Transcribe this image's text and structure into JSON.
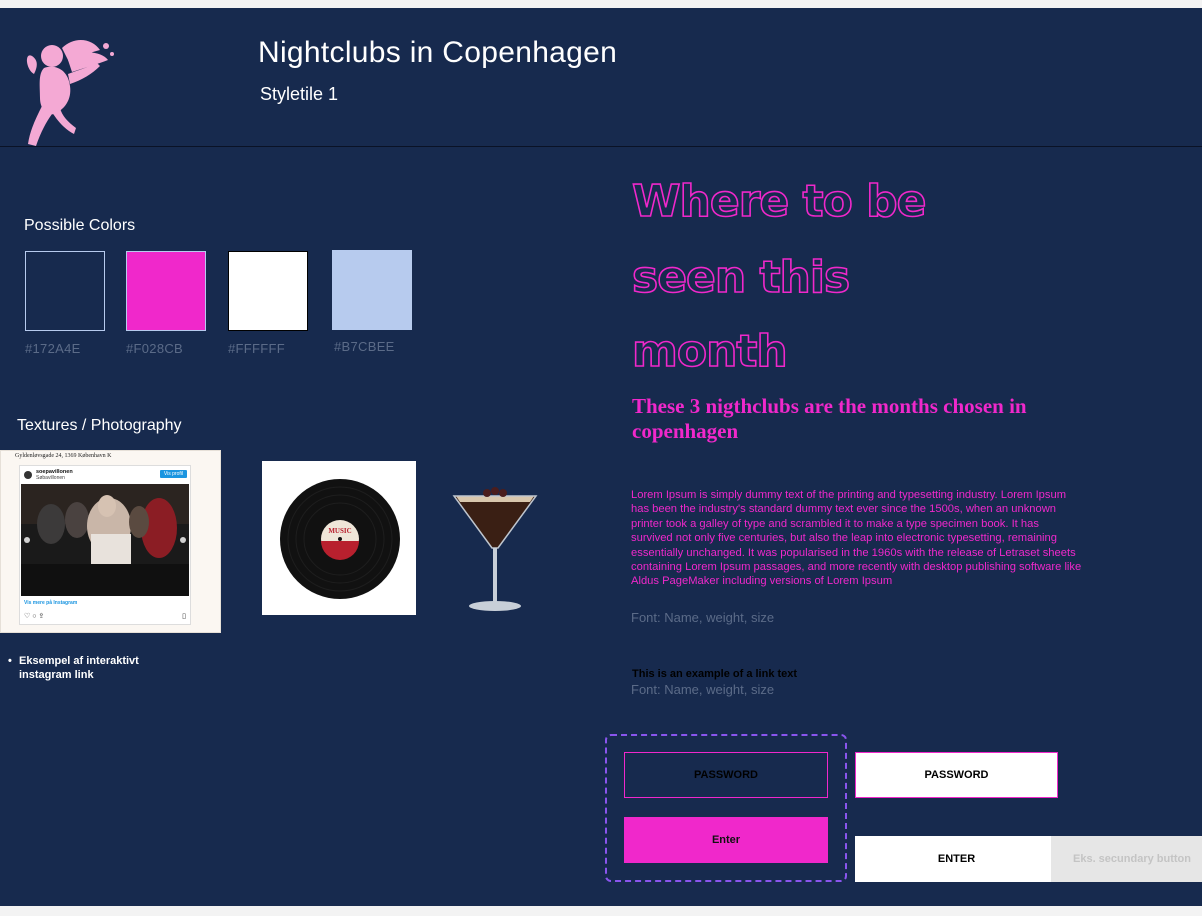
{
  "header": {
    "title": "Nightclubs in Copenhagen",
    "subtitle": "Styletile 1"
  },
  "colors": {
    "label": "Possible Colors",
    "swatches": [
      {
        "hex": "#172A4E",
        "label": "#172A4E"
      },
      {
        "hex": "#F028CB",
        "label": "#F028CB"
      },
      {
        "hex": "#FFFFFF",
        "label": "#FFFFFF"
      },
      {
        "hex": "#B7CBEE",
        "label": "#B7CBEE"
      }
    ]
  },
  "textures": {
    "label": "Textures / Photography",
    "instagram": {
      "address": "Gyldenløvsgade 24, 1369 København K",
      "username": "soepavillonen",
      "user_sub": "Søbavillonen",
      "profile_button": "Vis profil",
      "more_link": "Vis mere på Instagram",
      "action_icons": [
        "heart-icon",
        "comment-icon",
        "share-icon"
      ],
      "bookmark_icon": "bookmark-icon"
    },
    "vinyl_label": "MUSIC",
    "bullet": "Eksempel af interaktivt instagram link"
  },
  "headline": {
    "lines": [
      "Where to be",
      "seen this",
      "month"
    ],
    "color": "#F028CB"
  },
  "kicker": "These 3 nigthclubs are the months chosen in copenhagen",
  "body": "Lorem Ipsum is simply dummy text of the printing and typesetting industry. Lorem Ipsum has been the industry's standard dummy text ever since the 1500s, when an unknown printer took a galley of type and scrambled it to make a type specimen book. It has survived not only five centuries, but also the leap into electronic typesetting, remaining essentially unchanged. It was popularised in the 1960s with the release of Letraset sheets containing Lorem Ipsum passages, and more recently with desktop publishing software like Aldus PageMaker including versions of Lorem Ipsum",
  "font_note_1": "Font: Name, weight, size",
  "link_text": "This is an example of a link text",
  "font_note_2": "Font: Name, weight, size",
  "buttons": {
    "password_dark": "PASSWORD",
    "enter_pink": "Enter",
    "password_light": "PASSWORD",
    "enter_white": "ENTER",
    "secondary": "Eks. secundary button"
  }
}
